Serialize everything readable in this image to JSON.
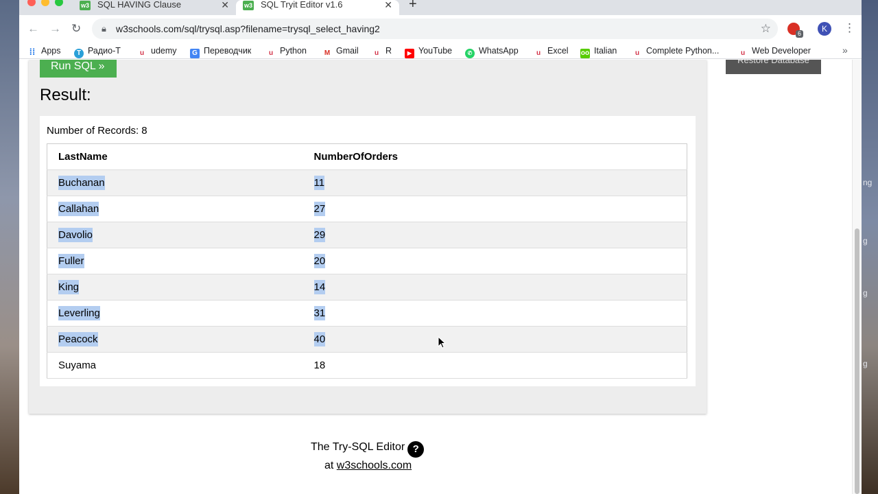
{
  "browser": {
    "tabs": [
      {
        "title": "SQL HAVING Clause",
        "active": false,
        "favicon": "w3"
      },
      {
        "title": "SQL Tryit Editor v1.6",
        "active": true,
        "favicon": "w3"
      }
    ],
    "url": "w3schools.com/sql/trysql.asp?filename=trysql_select_having2",
    "extension_badge": "6",
    "profile_initial": "K"
  },
  "bookmarks": [
    {
      "label": "Apps",
      "icon": "apps-grid-icon",
      "color": "#1a73e8"
    },
    {
      "label": "Радио-Т",
      "icon": "radio-t-icon",
      "color": "#2aa0d8"
    },
    {
      "label": "udemy",
      "icon": "udemy-icon",
      "color": "#d3344a"
    },
    {
      "label": "Переводчик",
      "icon": "translate-icon",
      "color": "#4285f4"
    },
    {
      "label": "Python",
      "icon": "udemy-icon",
      "color": "#d3344a"
    },
    {
      "label": "Gmail",
      "icon": "gmail-icon",
      "color": "#d93025"
    },
    {
      "label": "R",
      "icon": "udemy-icon",
      "color": "#d3344a"
    },
    {
      "label": "YouTube",
      "icon": "youtube-icon",
      "color": "#ff0000"
    },
    {
      "label": "WhatsApp",
      "icon": "whatsapp-icon",
      "color": "#25d366"
    },
    {
      "label": "Excel",
      "icon": "udemy-icon",
      "color": "#d3344a"
    },
    {
      "label": "Italian",
      "icon": "duolingo-icon",
      "color": "#58cc02"
    },
    {
      "label": "Complete Python...",
      "icon": "udemy-icon",
      "color": "#d3344a"
    },
    {
      "label": "Web Developer",
      "icon": "udemy-icon",
      "color": "#d3344a"
    }
  ],
  "page": {
    "run_button": "Run SQL »",
    "restore_button": "Restore Database",
    "result_title": "Result:",
    "records_label": "Number of Records:",
    "records_count": "8",
    "columns": [
      "LastName",
      "NumberOfOrders"
    ],
    "rows": [
      {
        "name": "Buchanan",
        "orders": "11",
        "selected": true
      },
      {
        "name": "Callahan",
        "orders": "27",
        "selected": true
      },
      {
        "name": "Davolio",
        "orders": "29",
        "selected": true
      },
      {
        "name": "Fuller",
        "orders": "20",
        "selected": true
      },
      {
        "name": "King",
        "orders": "14",
        "selected": true
      },
      {
        "name": "Leverling",
        "orders": "31",
        "selected": true
      },
      {
        "name": "Peacock",
        "orders": "40",
        "selected": true
      },
      {
        "name": "Suyama",
        "orders": "18",
        "selected": false
      }
    ],
    "footer_line1": "The Try-SQL Editor",
    "footer_help": "?",
    "footer_at": "at",
    "footer_link": "w3schools.com"
  },
  "desktop_fragments": [
    "ng",
    "g",
    "g",
    "g"
  ]
}
